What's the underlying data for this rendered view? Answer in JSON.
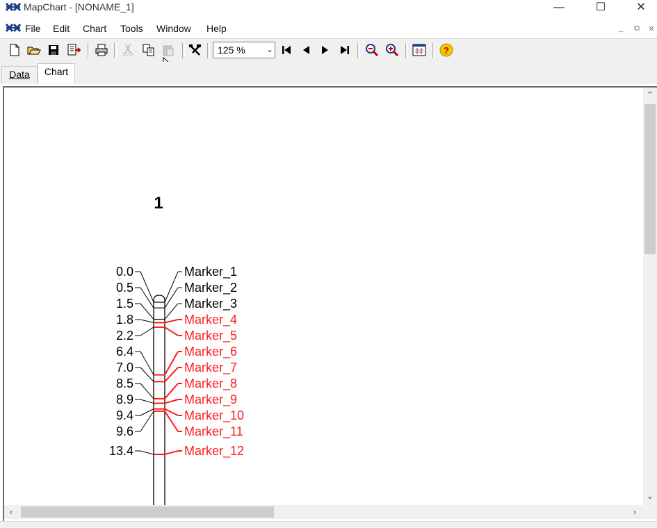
{
  "window": {
    "title": "MapChart - [NONAME_1]"
  },
  "menu": {
    "items": [
      "File",
      "Edit",
      "Chart",
      "Tools",
      "Window",
      "Help"
    ]
  },
  "toolbar": {
    "zoom_value": "125 %"
  },
  "tabs": {
    "data_label": "Data",
    "chart_label": "Chart"
  },
  "colors": {
    "normal": "#000000",
    "highlight": "#ff1a1a",
    "accent_help": "#f5c400"
  },
  "chart_data": {
    "type": "linkage-map",
    "title": "1",
    "unit": "",
    "loci": [
      {
        "position": 0.0,
        "label": "0.0",
        "marker": "Marker_1",
        "highlight": false
      },
      {
        "position": 0.5,
        "label": "0.5",
        "marker": "Marker_2",
        "highlight": false
      },
      {
        "position": 1.5,
        "label": "1.5",
        "marker": "Marker_3",
        "highlight": false
      },
      {
        "position": 1.8,
        "label": "1.8",
        "marker": "Marker_4",
        "highlight": true
      },
      {
        "position": 2.2,
        "label": "2.2",
        "marker": "Marker_5",
        "highlight": true
      },
      {
        "position": 6.4,
        "label": "6.4",
        "marker": "Marker_6",
        "highlight": true
      },
      {
        "position": 7.0,
        "label": "7.0",
        "marker": "Marker_7",
        "highlight": true
      },
      {
        "position": 8.5,
        "label": "8.5",
        "marker": "Marker_8",
        "highlight": true
      },
      {
        "position": 8.9,
        "label": "8.9",
        "marker": "Marker_9",
        "highlight": true
      },
      {
        "position": 9.4,
        "label": "9.4",
        "marker": "Marker_10",
        "highlight": true
      },
      {
        "position": 9.6,
        "label": "9.6",
        "marker": "Marker_11",
        "highlight": true
      },
      {
        "position": 13.4,
        "label": "13.4",
        "marker": "Marker_12",
        "highlight": true
      }
    ]
  }
}
